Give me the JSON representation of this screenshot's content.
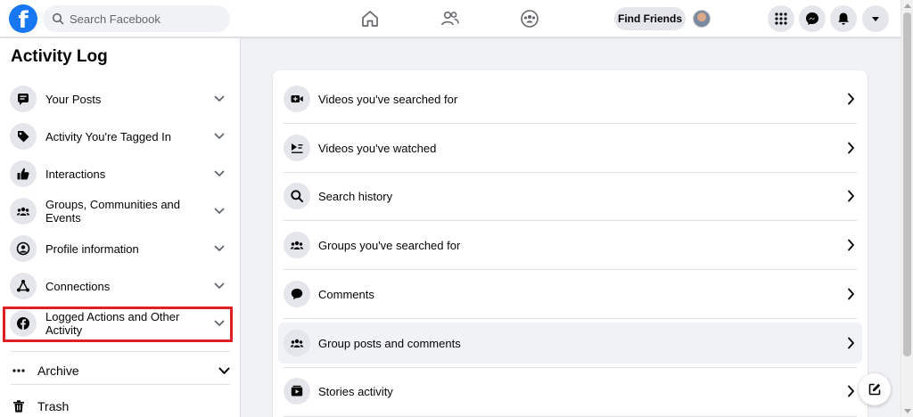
{
  "header": {
    "logo_letter": "f",
    "search": {
      "placeholder": "Search Facebook",
      "value": ""
    },
    "nav": [
      "home-icon",
      "friends-icon",
      "groups-icon"
    ],
    "find_friends_label": "Find Friends",
    "buttons": [
      "menu-grid-icon",
      "messenger-icon",
      "notifications-icon",
      "account-dropdown-icon"
    ]
  },
  "sidebar": {
    "title": "Activity Log",
    "items": [
      {
        "label": "Your Posts",
        "icon": "posts-icon"
      },
      {
        "label": "Activity You're Tagged In",
        "icon": "tag-icon"
      },
      {
        "label": "Interactions",
        "icon": "thumbs-up-icon"
      },
      {
        "label": "Groups, Communities and Events",
        "icon": "groups-icon"
      },
      {
        "label": "Profile information",
        "icon": "profile-icon"
      },
      {
        "label": "Connections",
        "icon": "connections-icon"
      },
      {
        "label": "Logged Actions and Other Activity",
        "icon": "facebook-icon"
      }
    ],
    "archive_label": "Archive",
    "trash_label": "Trash"
  },
  "main": {
    "rows": [
      {
        "label": "Videos you've searched for",
        "icon": "video-search-icon"
      },
      {
        "label": "Videos you've watched",
        "icon": "video-watched-icon"
      },
      {
        "label": "Search history",
        "icon": "search-icon"
      },
      {
        "label": "Groups you've searched for",
        "icon": "groups-icon"
      },
      {
        "label": "Comments",
        "icon": "comment-icon"
      },
      {
        "label": "Group posts and comments",
        "icon": "groups-icon"
      },
      {
        "label": "Stories activity",
        "icon": "stories-icon"
      }
    ]
  },
  "colors": {
    "brand": "#1877f2",
    "highlight": "#e02020",
    "background": "#f0f2f5",
    "icon_bg": "#e4e6eb"
  }
}
